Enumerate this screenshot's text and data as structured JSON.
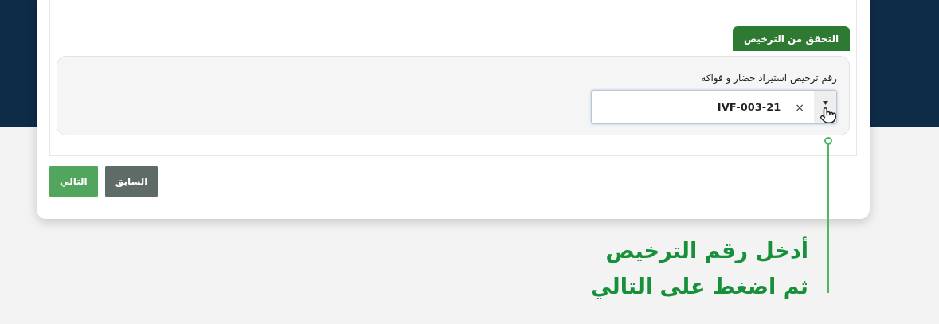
{
  "section_tab": {
    "label": "التحقق من الترخيص"
  },
  "field": {
    "label": "رقم ترخيص استيراد خضار و فواكه",
    "value": "IVF-003-21",
    "clear": "×",
    "dropdown_open": false
  },
  "buttons": [
    {
      "kind": "secondary",
      "label": "السابق"
    },
    {
      "kind": "primary",
      "label": "التالي"
    }
  ],
  "callout": {
    "lines": [
      "أدخل رقم الترخيص",
      "ثم اضغط على التالي"
    ]
  }
}
